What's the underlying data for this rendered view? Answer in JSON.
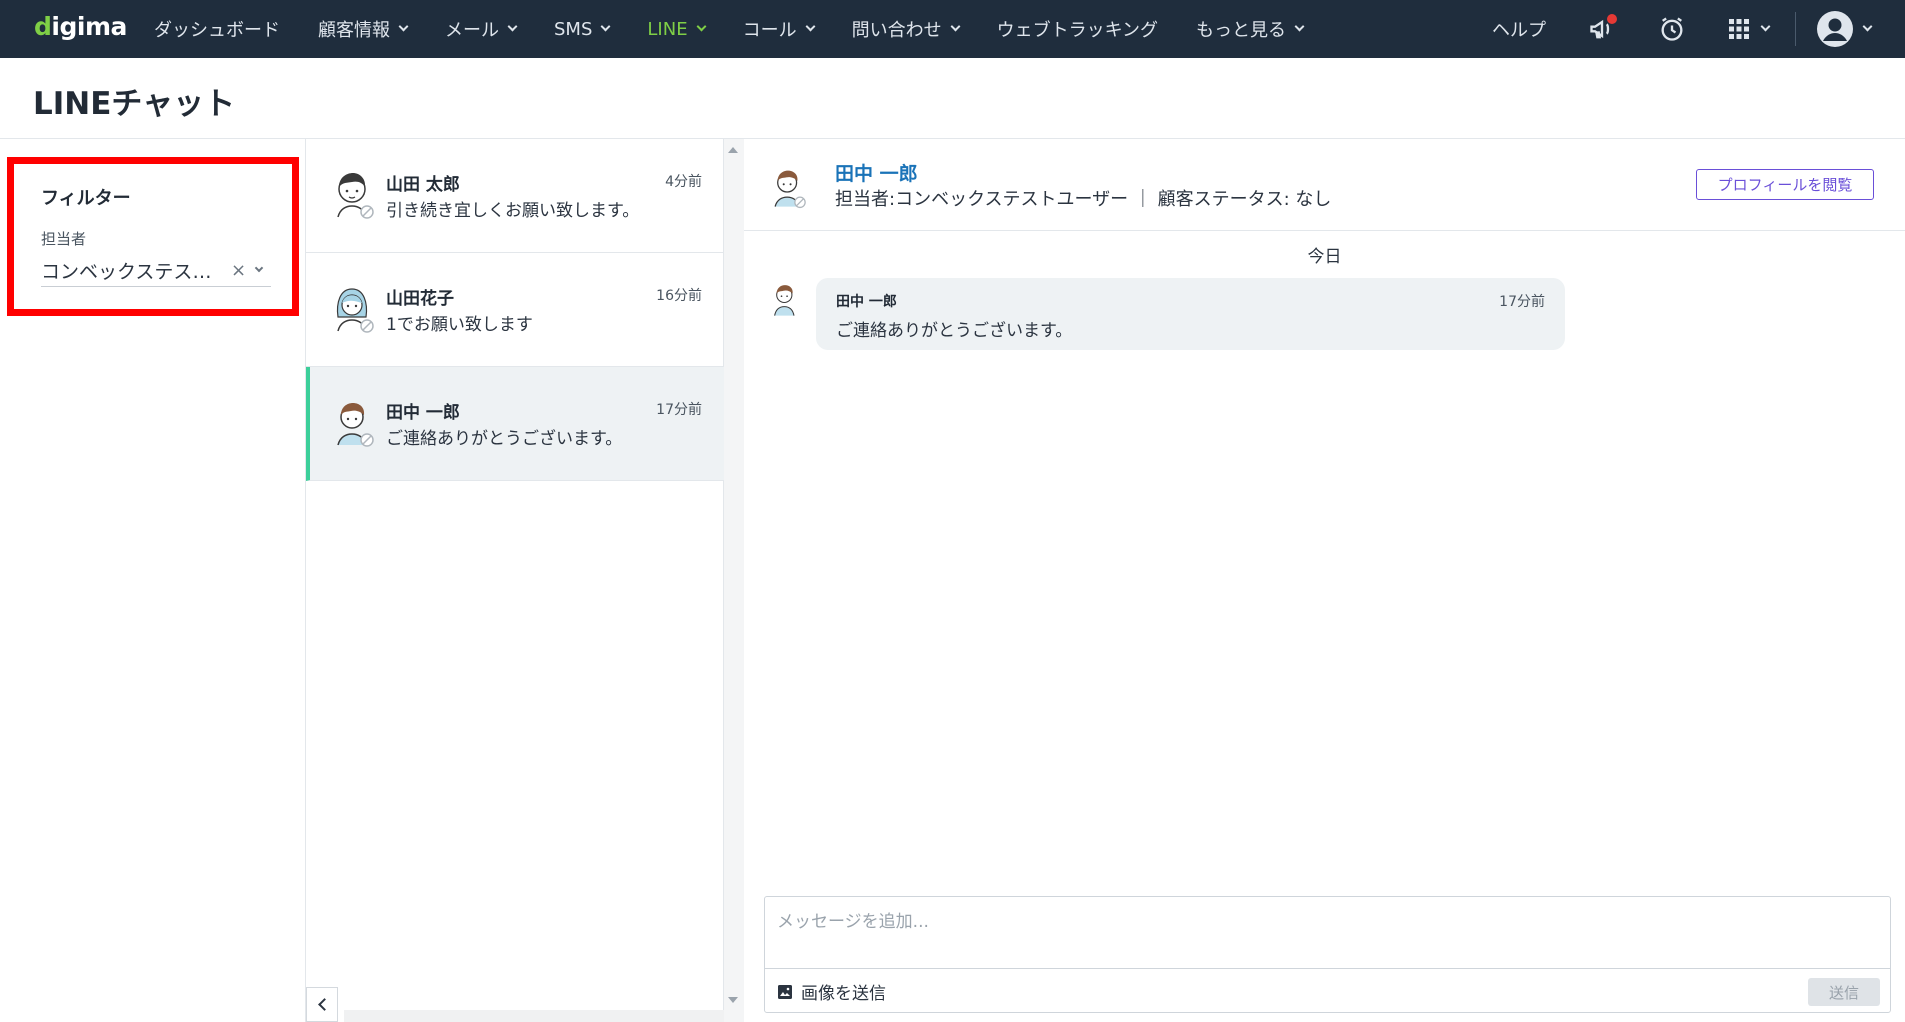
{
  "nav": {
    "logo_prefix": "d",
    "logo_rest": "igima",
    "items": [
      {
        "label": "ダッシュボード",
        "dropdown": false,
        "active": false
      },
      {
        "label": "顧客情報",
        "dropdown": true,
        "active": false
      },
      {
        "label": "メール",
        "dropdown": true,
        "active": false
      },
      {
        "label": "SMS",
        "dropdown": true,
        "active": false
      },
      {
        "label": "LINE",
        "dropdown": true,
        "active": true
      },
      {
        "label": "コール",
        "dropdown": true,
        "active": false
      },
      {
        "label": "問い合わせ",
        "dropdown": true,
        "active": false
      },
      {
        "label": "ウェブトラッキング",
        "dropdown": false,
        "active": false
      },
      {
        "label": "もっと見る",
        "dropdown": true,
        "active": false
      }
    ],
    "help_label": "ヘルプ",
    "icons": [
      "megaphone-icon",
      "alarm-clock-icon",
      "apps-grid-icon",
      "user-avatar-icon"
    ]
  },
  "page": {
    "title": "LINEチャット"
  },
  "filter": {
    "title": "フィルター",
    "assignee_label": "担当者",
    "assignee_value": "コンベックステスト…",
    "clear_symbol": "×"
  },
  "conversations": [
    {
      "name": "山田 太郎",
      "time": "4分前",
      "message": "引き続き宜しくお願い致します。",
      "selected": false
    },
    {
      "name": "山田花子",
      "time": "16分前",
      "message": "1でお願い致します",
      "selected": false
    },
    {
      "name": "田中 一郎",
      "time": "17分前",
      "message": "ご連絡ありがとうございます。",
      "selected": true
    }
  ],
  "chat": {
    "contact_name": "田中 一郎",
    "subtitle": "担当者:コンベックステストユーザー ｜ 顧客ステータス: なし",
    "profile_button": "プロフィールを閲覧",
    "date_divider": "今日",
    "messages": [
      {
        "sender": "田中 一郎",
        "time": "17分前",
        "text": "ご連絡ありがとうございます。"
      }
    ],
    "composer_placeholder": "メッセージを追加...",
    "image_send_label": "画像を送信",
    "send_label": "送信"
  },
  "colors": {
    "nav_bg": "#1f2d3d",
    "accent_green": "#7fcf46",
    "link_blue": "#1a73b8",
    "purple": "#6a4fd8",
    "selected_bar": "#3ccf9a",
    "highlight_red": "#ff0000"
  }
}
